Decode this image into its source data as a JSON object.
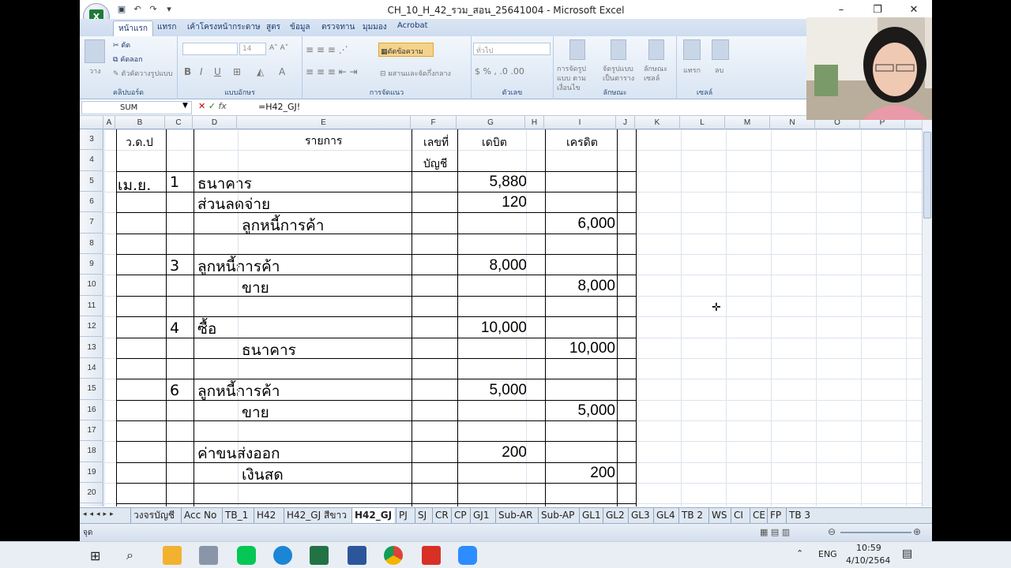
{
  "window": {
    "title": "CH_10_H_42_รวม_สอน_25641004 - Microsoft Excel",
    "controls": [
      "–",
      "❐",
      "✕"
    ]
  },
  "ribbon_tabs": [
    "หน้าแรก",
    "แทรก",
    "เค้าโครงหน้ากระดาษ",
    "สูตร",
    "ข้อมูล",
    "ตรวจทาน",
    "มุมมอง",
    "Acrobat"
  ],
  "ribbon": {
    "clipboard": {
      "cut": "ตัด",
      "copy": "คัดลอก",
      "paste": "วาง",
      "format_painter": "ตัวคัดวางรูปแบบ",
      "label": "คลิปบอร์ด"
    },
    "font": {
      "size": "14",
      "label": "แบบอักษร"
    },
    "alignment": {
      "wrap": "ตัดข้อความ",
      "merge": "ผสานและจัดกึ่งกลาง",
      "label": "การจัดแนว"
    },
    "number": {
      "format": "ทั่วไป",
      "label": "ตัวเลข"
    },
    "styles": {
      "cond": "การจัดรูปแบบ ตามเงื่อนไข",
      "table": "จัดรูปแบบ เป็นตาราง",
      "cell": "ลักษณะ เซลล์",
      "label": "ลักษณะ"
    },
    "cells": {
      "insert": "แทรก",
      "delete": "ลบ",
      "label": "เซลล์"
    }
  },
  "formula_bar": {
    "name_box": "SUM",
    "fx": "fx",
    "formula": "=H42_GJ!"
  },
  "columns": [
    "A",
    "B",
    "C",
    "D",
    "E",
    "F",
    "G",
    "H",
    "I",
    "J",
    "K",
    "L",
    "M",
    "N",
    "O",
    "P"
  ],
  "rows": [
    "3",
    "4",
    "5",
    "6",
    "7",
    "8",
    "9",
    "10",
    "11",
    "12",
    "13",
    "14",
    "15",
    "16",
    "17",
    "18",
    "19",
    "20"
  ],
  "sheet": {
    "header": {
      "date": "ว.ด.ป",
      "desc": "รายการ",
      "ref1": "เลขที่",
      "ref2": "บัญชี",
      "debit": "เดบิต",
      "credit": "เครดิต"
    },
    "entries": [
      {
        "month": "เม.ย.",
        "day": "1",
        "account": "ธนาคาร",
        "debit": "5,880"
      },
      {
        "account": "ส่วนลดจ่าย",
        "debit": "120"
      },
      {
        "account_indent": "ลูกหนี้การค้า",
        "credit": "6,000"
      },
      {
        "day": "3",
        "account": "ลูกหนี้การค้า",
        "debit": "8,000"
      },
      {
        "account_indent": "ขาย",
        "credit": "8,000"
      },
      {
        "day": "4",
        "account": "ซื้อ",
        "debit": "10,000"
      },
      {
        "account_indent": "ธนาคาร",
        "credit": "10,000"
      },
      {
        "day": "6",
        "account": "ลูกหนี้การค้า",
        "debit": "5,000"
      },
      {
        "account_indent": "ขาย",
        "credit": "5,000"
      },
      {
        "account": "ค่าขนส่งออก",
        "debit": "200"
      },
      {
        "account_indent": "เงินสด",
        "credit": "200"
      }
    ]
  },
  "sheet_tabs": [
    "วงจรบัญชี",
    "Acc No",
    "TB_1",
    "H42",
    "H42_GJ สีขาว",
    "H42_GJ",
    "PJ",
    "SJ",
    "CR",
    "CP",
    "GJ1",
    "Sub-AR",
    "Sub-AP",
    "GL1",
    "GL2",
    "GL3",
    "GL4",
    "TB 2",
    "WS",
    "CI",
    "CE",
    "FP",
    "TB 3"
  ],
  "active_sheet": "H42_GJ",
  "status": {
    "mode": "จุด"
  },
  "taskbar": {
    "lang": "ENG",
    "time": "10:59",
    "date": "4/10/2564"
  },
  "colors": {
    "accent": "#1f7a3a",
    "ribbon": "#dbe6f4",
    "grid": "#dbe3ee"
  }
}
